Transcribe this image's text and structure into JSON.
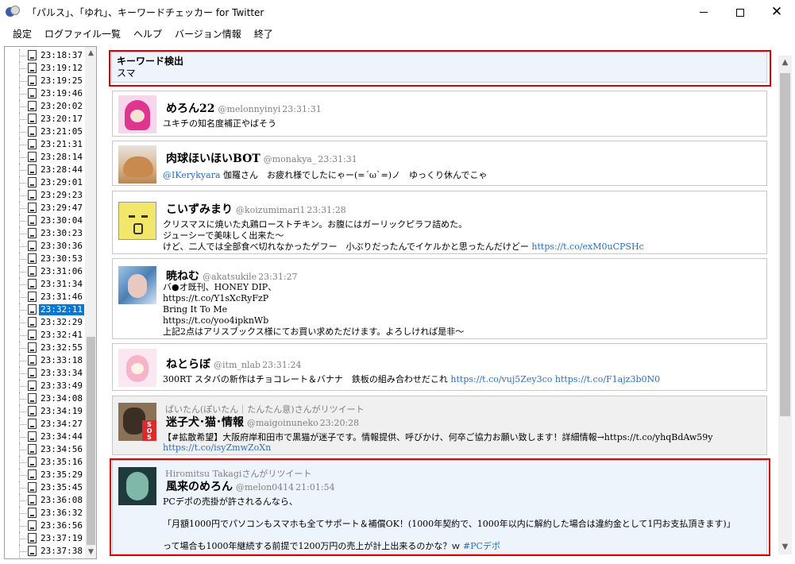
{
  "window": {
    "title": "「パルス」、「ゆれ」、キーワードチェッカー for Twitter",
    "controls": {
      "minimize": "",
      "maximize": "",
      "close": "✕"
    }
  },
  "menu": [
    "設定",
    "ログファイル一覧",
    "ヘルプ",
    "バージョン情報",
    "終了"
  ],
  "tree": {
    "times": [
      "23:18:37",
      "23:19:12",
      "23:19:25",
      "23:19:46",
      "23:20:02",
      "23:20:17",
      "23:21:05",
      "23:21:31",
      "23:28:14",
      "23:28:44",
      "23:29:01",
      "23:29:23",
      "23:29:47",
      "23:30:04",
      "23:30:23",
      "23:30:36",
      "23:30:53",
      "23:31:06",
      "23:31:34",
      "23:31:46",
      "23:32:11",
      "23:32:29",
      "23:32:41",
      "23:32:55",
      "23:33:18",
      "23:33:34",
      "23:33:49",
      "23:34:08",
      "23:34:19",
      "23:34:27",
      "23:34:44",
      "23:34:56",
      "23:35:16",
      "23:35:29",
      "23:35:45",
      "23:36:08",
      "23:36:32",
      "23:36:56",
      "23:37:19",
      "23:37:38"
    ],
    "selected_index": 20
  },
  "keyword": {
    "title": "キーワード検出",
    "value": "スマ"
  },
  "tweets": [
    {
      "name": "めろん22",
      "handle": "@melonnyinyi",
      "time": "23:31:31",
      "lines": [
        {
          "text": "ユキチの知名度補正やばそう",
          "link": ""
        }
      ]
    },
    {
      "name": "肉球ほいほいBOT",
      "handle": "@monakya_",
      "time": "23:31:31",
      "lines": [
        {
          "prefix_link": "@IKerykyara",
          "text": " 伽羅さん　お疲れ様でしたにゃー(=´ω`=)ノ　ゆっくり休んでこゃ",
          "link": ""
        }
      ]
    },
    {
      "name": "こいずみまり",
      "handle": "@koizumimari1",
      "time": "23:31:28",
      "lines": [
        {
          "text": "クリスマスに焼いた丸鶏ローストチキン。お腹にはガーリックピラフ詰めた。",
          "link": ""
        },
        {
          "text": "ジューシーで美味しく出来た～",
          "link": ""
        },
        {
          "text": "けど、二人では全部食べ切れなかったゲフー　小ぶりだったんでイケルかと思ったんだけどー ",
          "link": "https://t.co/exM0uCPSHc"
        }
      ]
    },
    {
      "name": "暁ねむ",
      "handle": "@akatsukile",
      "time": "23:31:27",
      "lines": [
        {
          "text": "バ●オ既刊、HONEY DIP、",
          "link": ""
        },
        {
          "text": "https://t.co/Y1sXcRyFzP",
          "link": ""
        },
        {
          "text": "Bring It To Me",
          "link": ""
        },
        {
          "text": "https://t.co/yoo4ipknWb",
          "link": ""
        },
        {
          "text": "上記2点はアリスブックス様にてお買い求めただけます。よろしければ是非～",
          "link": ""
        }
      ]
    },
    {
      "name": "ねとらぼ",
      "handle": "@itm_nlab",
      "time": "23:31:24",
      "lines": [
        {
          "text": "300RT スタバの新作はチョコレート＆バナナ　鉄板の組み合わせだこれ ",
          "link": "https://t.co/vuj5Zey3co https://t.co/F1ajz3b0N0"
        }
      ]
    },
    {
      "retweeter": "ぱいたん(ぽいたん｜たんたん意)さんがリツイート",
      "name": "迷子犬･猫･情報",
      "handle": "@maigoinuneko",
      "time": "23:20:28",
      "lines": [
        {
          "text": "【#拡散希望】大阪府岸和田市で黒猫が迷子です。情報提供、呼びかけ、何卒ご協力お願い致します！詳細情報→https://t.co/yhqBdAw59y",
          "link": ""
        },
        {
          "text": "",
          "link": "https://t.co/isyZmwZoXn"
        }
      ]
    },
    {
      "retweeter": "Hiromitsu Takagiさんがリツイート",
      "name": "風来のめろん",
      "handle": "@melon0414",
      "time": "21:01:54",
      "lines": [
        {
          "text": "PCデポの売掛が許されるんなら、",
          "link": ""
        },
        {
          "text": "「月額1000円でパソコンもスマホも全てサポート＆補償OK！(1000年契約で、1000年以内に解約した場合は違約金として1円お支払頂きます)」",
          "link": ""
        },
        {
          "text": "って場合も1000年継続する前提で1200万円の売上が計上出来るのかな？ｗ ",
          "link": "#PCデポ"
        }
      ]
    }
  ],
  "colors": {
    "selection": "#0078d7",
    "highlight": "#e00000",
    "link": "#2a6fc0",
    "keyword_bg": "#eef4fb"
  }
}
